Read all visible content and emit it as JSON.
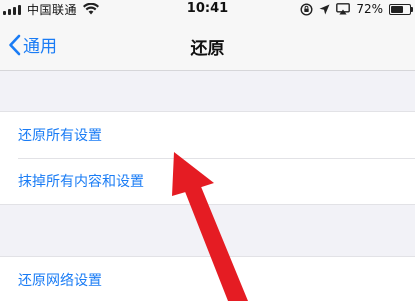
{
  "status_bar": {
    "carrier": "中国联通",
    "time": "10:41",
    "battery": "72%",
    "battery_level": 0.72,
    "icons": [
      "signal-bars-icon",
      "wifi-icon",
      "orientation-lock-icon",
      "location-icon",
      "airplay-icon",
      "battery-icon"
    ]
  },
  "nav": {
    "back_label": "通用",
    "title": "还原"
  },
  "groups": [
    {
      "items": [
        {
          "label": "还原所有设置"
        },
        {
          "label": "抹掉所有内容和设置"
        }
      ]
    },
    {
      "items": [
        {
          "label": "还原网络设置"
        }
      ]
    }
  ],
  "colors": {
    "accent": "#1a7cf5",
    "background": "#f2f2f7",
    "annotation_arrow": "#e51c23"
  }
}
